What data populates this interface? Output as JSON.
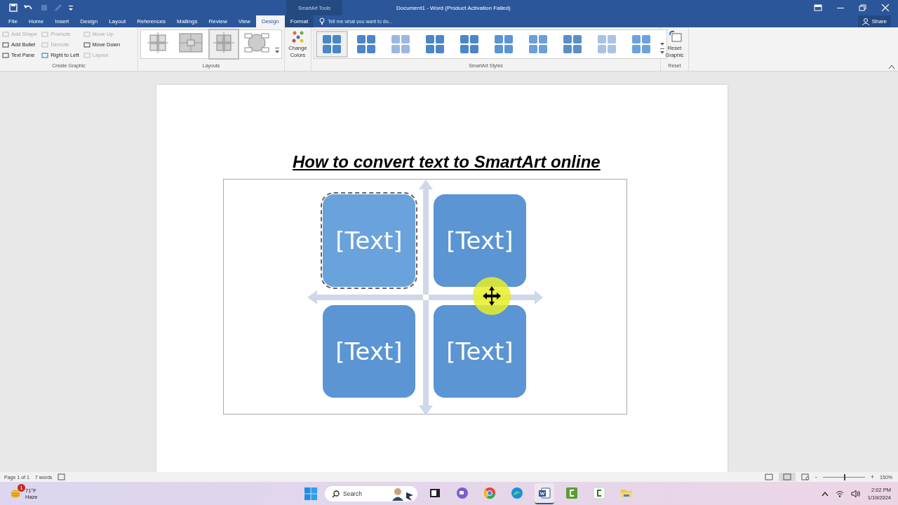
{
  "title_bar": {
    "context_label": "SmartArt Tools",
    "title": "Document1 - Word (Product Activation Failed)"
  },
  "tabs": [
    {
      "label": "File",
      "selected": false,
      "kind": "normal"
    },
    {
      "label": "Home",
      "selected": false,
      "kind": "normal"
    },
    {
      "label": "Insert",
      "selected": false,
      "kind": "normal"
    },
    {
      "label": "Design",
      "selected": false,
      "kind": "normal"
    },
    {
      "label": "Layout",
      "selected": false,
      "kind": "normal"
    },
    {
      "label": "References",
      "selected": false,
      "kind": "normal"
    },
    {
      "label": "Mailings",
      "selected": false,
      "kind": "normal"
    },
    {
      "label": "Review",
      "selected": false,
      "kind": "normal"
    },
    {
      "label": "View",
      "selected": false,
      "kind": "normal"
    },
    {
      "label": "Design",
      "selected": true,
      "kind": "contextual"
    },
    {
      "label": "Format",
      "selected": false,
      "kind": "contextual"
    }
  ],
  "tell_me": {
    "placeholder": "Tell me what you want to do..."
  },
  "share": "Share",
  "ribbon": {
    "create_graphic": {
      "label": "Create Graphic",
      "columns": [
        [
          {
            "label": "Add Shape",
            "disabled": true
          },
          {
            "label": "Add Bullet",
            "disabled": false
          },
          {
            "label": "Text Pane",
            "disabled": false
          }
        ],
        [
          {
            "label": "Promote",
            "disabled": true
          },
          {
            "label": "Demote",
            "disabled": true
          },
          {
            "label": "Right to Left",
            "disabled": false
          }
        ],
        [
          {
            "label": "Move Up",
            "disabled": true
          },
          {
            "label": "Move Down",
            "disabled": false
          },
          {
            "label": "Layout",
            "disabled": true
          }
        ]
      ]
    },
    "layouts": {
      "label": "Layouts",
      "items": [
        {
          "selected": false
        },
        {
          "selected": false
        },
        {
          "selected": true
        },
        {
          "selected": false
        }
      ]
    },
    "change_colors": "Change Colors",
    "styles": {
      "label": "SmartArt Styles",
      "items": [
        {
          "selected": true
        },
        {
          "selected": false
        },
        {
          "selected": false
        },
        {
          "selected": false
        },
        {
          "selected": false
        },
        {
          "selected": false
        },
        {
          "selected": false
        },
        {
          "selected": false
        },
        {
          "selected": false
        },
        {
          "selected": false
        }
      ]
    },
    "reset": {
      "label": "Reset",
      "button": "Reset Graphic"
    }
  },
  "document": {
    "heading": "How to convert text to SmartArt online",
    "smartart": {
      "shapes": [
        {
          "text": "[Text]",
          "selected": true
        },
        {
          "text": "[Text]",
          "selected": false
        },
        {
          "text": "[Text]",
          "selected": false
        },
        {
          "text": "[Text]",
          "selected": false
        }
      ]
    }
  },
  "status_bar": {
    "page": "Page 1 of 1",
    "words": "7 words",
    "zoom": "150%",
    "zoom_minus": "-",
    "zoom_plus": "+",
    "zoom_level": {
      "level": 0.5
    }
  },
  "taskbar": {
    "weather": {
      "badge": "1",
      "temperature": "71°F",
      "condition": "Haze"
    },
    "search": {
      "placeholder": "Search"
    },
    "apps": [
      {
        "kind": "files",
        "selected": false
      },
      {
        "kind": "chat",
        "selected": false
      },
      {
        "kind": "browser",
        "selected": false
      },
      {
        "kind": "edge",
        "selected": false
      },
      {
        "kind": "word",
        "selected": true
      },
      {
        "kind": "camtasia",
        "selected": false
      },
      {
        "kind": "camtasia2",
        "selected": false
      },
      {
        "kind": "folder",
        "selected": false
      }
    ],
    "time": "2:02 PM",
    "date": "1/19/2024"
  }
}
